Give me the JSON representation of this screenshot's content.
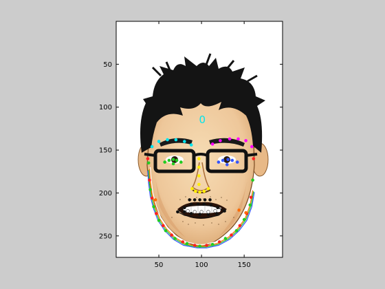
{
  "figure": {
    "background_color": "#cccccc",
    "axes_background": "#ffffff"
  },
  "chart_data": {
    "type": "scatter",
    "title": "",
    "xlabel": "",
    "ylabel": "",
    "xlim": [
      0,
      195
    ],
    "ylim": [
      0,
      275
    ],
    "y_reversed": true,
    "grid": false,
    "legend": "none",
    "background_image": "cartoon face illustration (man with spiky black hair and black rectangular glasses)",
    "x_ticks": [
      50,
      100,
      150
    ],
    "y_ticks": [
      50,
      100,
      150,
      200,
      250
    ],
    "annotations": [
      {
        "text": "0",
        "x": 101,
        "y": 115,
        "color": "#00e5ee"
      }
    ],
    "series": [
      {
        "key": "jaw-outline",
        "style": "line",
        "color": "#ffffff",
        "x": [
          40,
          41,
          43,
          47,
          52,
          60,
          70,
          82,
          95,
          103,
          117,
          130,
          141,
          150,
          156,
          159
        ],
        "y": [
          170,
          185,
          200,
          215,
          228,
          240,
          250,
          257,
          260,
          260,
          257,
          250,
          240,
          228,
          212,
          195
        ]
      },
      {
        "key": "jaw-outline-orange",
        "style": "line",
        "color": "#ff6a00",
        "x": [
          39,
          40,
          42,
          46,
          51,
          59,
          69,
          81,
          95,
          104,
          118,
          131,
          142,
          151,
          157,
          160
        ],
        "y": [
          172,
          187,
          202,
          217,
          230,
          242,
          252,
          259,
          262,
          262,
          259,
          252,
          242,
          230,
          214,
          197
        ]
      },
      {
        "key": "jaw-outline-green",
        "style": "line",
        "color": "#22cc22",
        "x": [
          38,
          39,
          41,
          45,
          50,
          58,
          68,
          80,
          95,
          105,
          119,
          132,
          143,
          152,
          158,
          161
        ],
        "y": [
          173,
          188,
          203,
          218,
          231,
          243,
          253,
          260,
          263,
          263,
          260,
          253,
          243,
          231,
          215,
          198
        ]
      },
      {
        "key": "jaw-outline-blue",
        "style": "line",
        "color": "#3355ff",
        "x": [
          37,
          38,
          40,
          44,
          49,
          57,
          67,
          79,
          95,
          106,
          120,
          133,
          144,
          153,
          159,
          162
        ],
        "y": [
          174,
          189,
          204,
          219,
          232,
          244,
          254,
          261,
          264,
          264,
          261,
          254,
          244,
          232,
          216,
          199
        ]
      },
      {
        "key": "jaw-points",
        "style": "points",
        "color": "#ff2222",
        "x": [
          37,
          39,
          42,
          47,
          55,
          65,
          78,
          92,
          106,
          121,
          135,
          145,
          153,
          158,
          161
        ],
        "y": [
          160,
          185,
          206,
          224,
          238,
          249,
          257,
          261,
          261,
          257,
          249,
          238,
          224,
          205,
          160
        ]
      },
      {
        "key": "jaw-points-green",
        "style": "points",
        "color": "#22cc22",
        "x": [
          38,
          40,
          44,
          50,
          58,
          69,
          83,
          98,
          113,
          128,
          141,
          150,
          157,
          160
        ],
        "y": [
          165,
          196,
          216,
          232,
          244,
          253,
          259,
          262,
          260,
          253,
          244,
          231,
          214,
          185
        ]
      },
      {
        "key": "left-brow",
        "style": "points",
        "color": "#00e5ee",
        "x": [
          42,
          50,
          60,
          70,
          80,
          88
        ],
        "y": [
          146,
          140,
          138,
          138,
          140,
          144
        ]
      },
      {
        "key": "right-brow",
        "style": "points",
        "color": "#ff00ff",
        "x": [
          113,
          122,
          133,
          143,
          152,
          159
        ],
        "y": [
          143,
          139,
          137,
          137,
          139,
          146
        ]
      },
      {
        "key": "left-eye",
        "style": "points",
        "color": "#22cc22",
        "x": [
          57,
          62,
          67,
          71,
          76,
          67
        ],
        "y": [
          164,
          162,
          161,
          162,
          164,
          166
        ]
      },
      {
        "key": "right-eye",
        "style": "points",
        "color": "#3355ff",
        "x": [
          120,
          125,
          131,
          136,
          142,
          130
        ],
        "y": [
          164,
          162,
          161,
          162,
          164,
          167
        ]
      },
      {
        "key": "nose",
        "style": "points",
        "color": "#ffee00",
        "x": [
          97,
          97,
          97,
          97,
          89,
          93,
          98,
          103,
          108
        ],
        "y": [
          160,
          170,
          180,
          190,
          195,
          198,
          199,
          198,
          195
        ]
      },
      {
        "key": "mouth-outer",
        "style": "line",
        "color": "#111111",
        "x": [
          72,
          80,
          88,
          96,
          103,
          111,
          119,
          127,
          120,
          111,
          100,
          90,
          80,
          72
        ],
        "y": [
          222,
          217,
          214,
          214,
          214,
          215,
          217,
          221,
          226,
          228,
          229,
          228,
          226,
          222
        ]
      },
      {
        "key": "mouth-points",
        "style": "points",
        "color": "#111111",
        "x": [
          72,
          80,
          88,
          96,
          103,
          111,
          119,
          127,
          118,
          108,
          98,
          88,
          80
        ],
        "y": [
          222,
          217,
          213,
          213,
          213,
          214,
          217,
          221,
          224,
          225,
          225,
          224,
          222
        ]
      },
      {
        "key": "mouth-inner",
        "style": "points",
        "color": "#ffffff",
        "x": [
          84,
          92,
          100,
          108,
          116
        ],
        "y": [
          221,
          222,
          222,
          222,
          221
        ]
      },
      {
        "key": "upper-lip-dots",
        "style": "points",
        "color": "#111111",
        "x": [
          86,
          92,
          98,
          104,
          110
        ],
        "y": [
          208,
          208,
          208,
          208,
          208
        ]
      },
      {
        "key": "chin-dots",
        "style": "points",
        "color": "#ff6a00",
        "x": [
          46,
          152,
          144
        ],
        "y": [
          208,
          223,
          220
        ]
      }
    ]
  }
}
